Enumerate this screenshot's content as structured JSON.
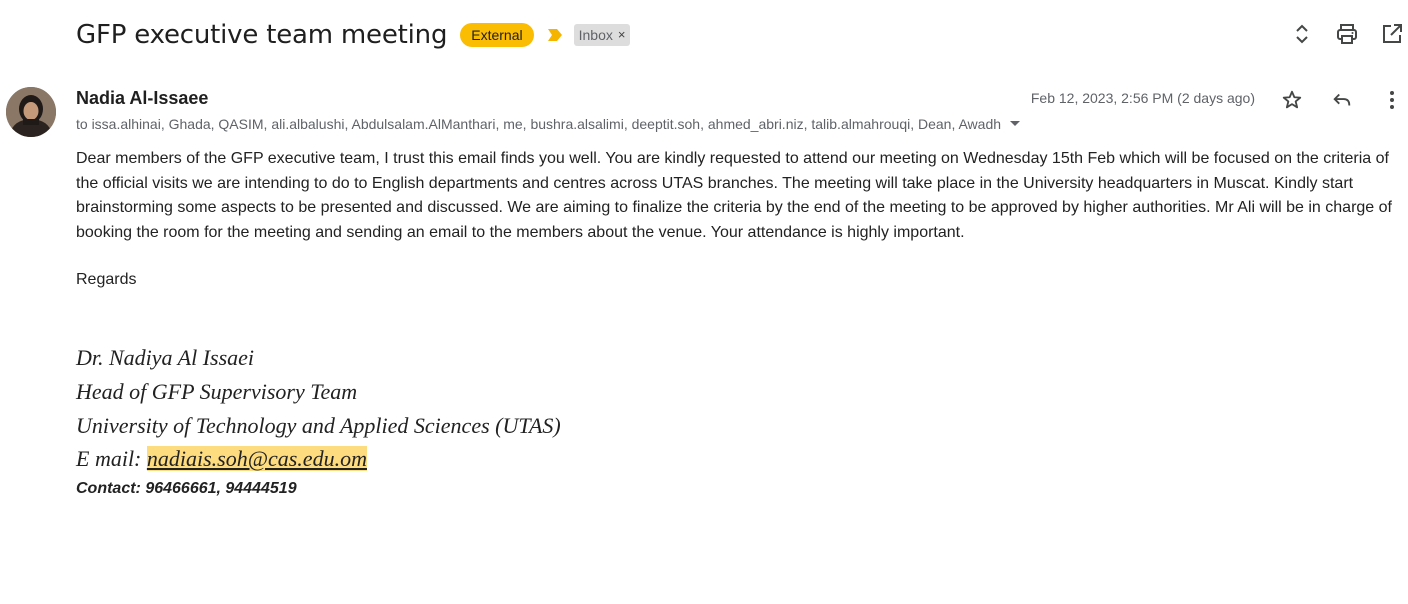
{
  "subject": {
    "title": "GFP executive team meeting",
    "labels": {
      "external": "External",
      "inbox": "Inbox",
      "inbox_remove": "×"
    }
  },
  "toolbar": {
    "icons": [
      "expand-collapse-icon",
      "print-icon",
      "open-in-new-window-icon"
    ]
  },
  "message": {
    "sender_name": "Nadia Al-Issaee",
    "recipients": "to issa.alhinai, Ghada, QASIM, ali.albalushi, Abdulsalam.AlManthari, me, bushra.alsalimi, deeptit.soh, ahmed_abri.niz, talib.almahrouqi, Dean, Awadh",
    "date": "Feb 12, 2023, 2:56 PM (2 days ago)",
    "actions": [
      "star-icon",
      "reply-icon",
      "more-options-icon"
    ],
    "body": "Dear members of the GFP executive team, I trust this email finds you well. You are kindly requested to attend our meeting on Wednesday 15th Feb which will be focused on the criteria of the official visits we are intending to do to English departments and centres across UTAS branches. The meeting will take place in the University headquarters in Muscat.  Kindly start brainstorming some aspects to be presented and discussed. We are aiming to finalize the criteria by the end of the meeting to be approved by higher authorities. Mr Ali will be in charge of booking the room for the meeting and sending an email to the members about the venue. Your attendance is highly important.",
    "regards": "Regards",
    "signature": {
      "name": "Dr. Nadiya Al Issaei",
      "role": "Head of GFP Supervisory Team",
      "organization": "University of Technology and Applied Sciences (UTAS)",
      "email_label": "E mail: ",
      "email": "nadiais.soh@cas.edu.om",
      "contact": "Contact: 96466661, 94444519"
    }
  },
  "colors": {
    "external_label": "#fbbc04",
    "inbox_label": "#dddddd",
    "email_highlight": "#fddc7f",
    "muted_text": "#5f6368"
  }
}
